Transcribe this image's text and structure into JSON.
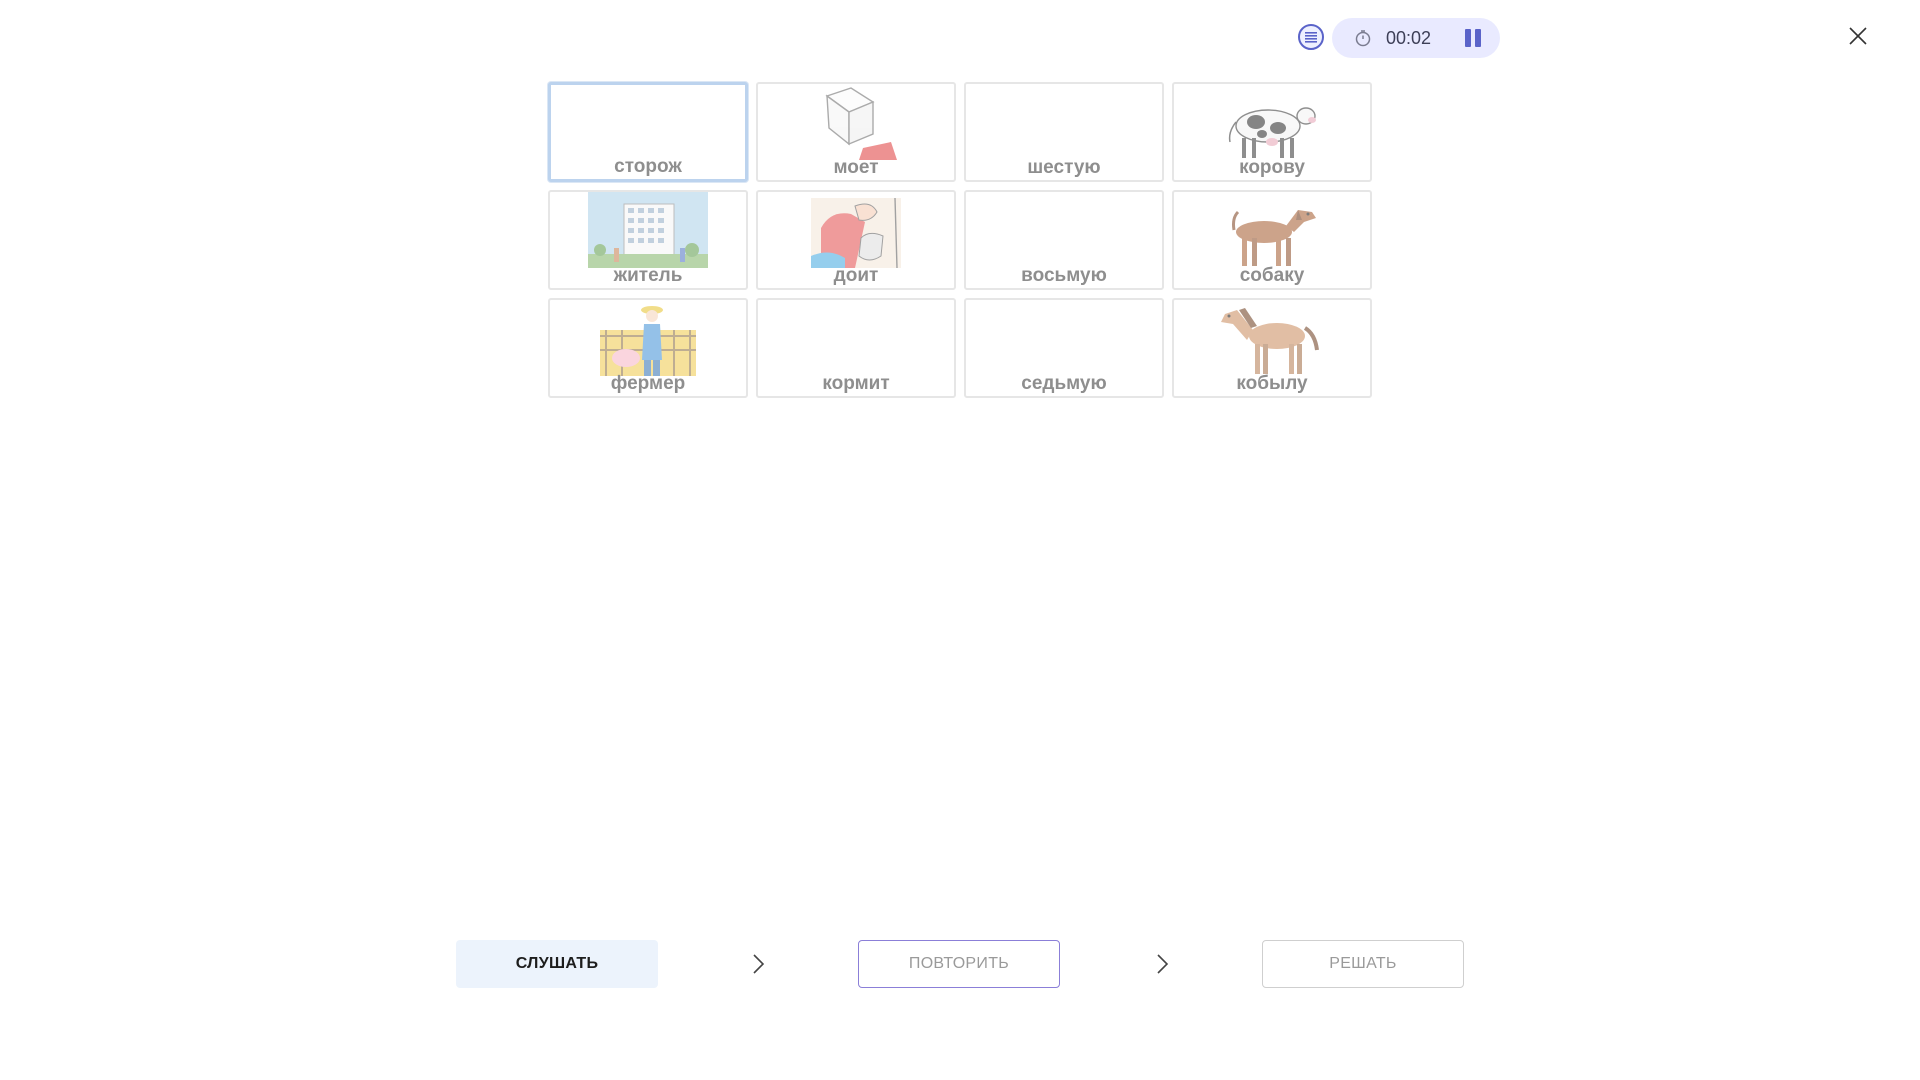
{
  "timer": {
    "time": "00:02"
  },
  "cards": [
    {
      "label": "сторож",
      "icon": "blank",
      "selected": true
    },
    {
      "label": "моет",
      "icon": "box-illustration"
    },
    {
      "label": "шестую",
      "icon": "blank"
    },
    {
      "label": "корову",
      "icon": "cow-picture"
    },
    {
      "label": "житель",
      "icon": "apartment-building-picture"
    },
    {
      "label": "доит",
      "icon": "milking-illustration"
    },
    {
      "label": "восьмую",
      "icon": "blank"
    },
    {
      "label": "собаку",
      "icon": "dog-picture"
    },
    {
      "label": "фермер",
      "icon": "farmer-picture"
    },
    {
      "label": "кормит",
      "icon": "blank"
    },
    {
      "label": "седьмую",
      "icon": "blank"
    },
    {
      "label": "кобылу",
      "icon": "horse-picture"
    }
  ],
  "buttons": {
    "listen": "СЛУШАТЬ",
    "repeat": "ПОВТОРИТЬ",
    "solve": "РЕШАТЬ"
  },
  "colors": {
    "accent": "#5a63c9",
    "timer_bg": "#e9eaff",
    "selected_border": "#bcd3ee",
    "listen_bg": "#ecf3fc",
    "repeat_border": "#8b7fd8"
  }
}
